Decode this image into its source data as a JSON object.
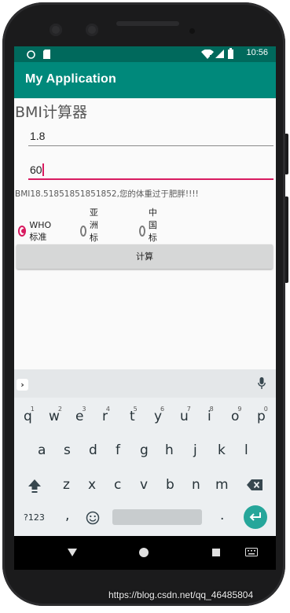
{
  "status_bar": {
    "time": "10:56"
  },
  "app_bar": {
    "title": "My Application"
  },
  "main": {
    "heading": "BMI计算器",
    "height_input": {
      "value": "1.8"
    },
    "weight_input": {
      "value": "60"
    },
    "result_text": "BMI18.51851851851852,您的体重过于肥胖!!!!",
    "standards": [
      {
        "label": "WHO标准",
        "checked": true
      },
      {
        "label": "亚洲标准",
        "checked": false
      },
      {
        "label": "中国标准",
        "checked": false
      }
    ],
    "calculate_label": "计算"
  },
  "keyboard": {
    "row1": [
      {
        "key": "q",
        "hint": "1"
      },
      {
        "key": "w",
        "hint": "2"
      },
      {
        "key": "e",
        "hint": "3"
      },
      {
        "key": "r",
        "hint": "4"
      },
      {
        "key": "t",
        "hint": "5"
      },
      {
        "key": "y",
        "hint": "6"
      },
      {
        "key": "u",
        "hint": "7"
      },
      {
        "key": "i",
        "hint": "8"
      },
      {
        "key": "o",
        "hint": "9"
      },
      {
        "key": "p",
        "hint": "0"
      }
    ],
    "row2": [
      "a",
      "s",
      "d",
      "f",
      "g",
      "h",
      "j",
      "k",
      "l"
    ],
    "row3": [
      "z",
      "x",
      "c",
      "v",
      "b",
      "n",
      "m"
    ],
    "symbols_label": "?123",
    "comma_label": ",",
    "period_label": "."
  },
  "watermark": "https://blog.csdn.net/qq_46485804",
  "colors": {
    "primary": "#00897b",
    "primary_dark": "#00695c",
    "accent": "#d81b60",
    "enter_key": "#26a69a"
  },
  "icons": [
    "wifi-icon",
    "signal-icon",
    "battery-icon",
    "sim-icon",
    "expand-suggestions-icon",
    "mic-icon",
    "shift-icon",
    "backspace-icon",
    "emoji-icon",
    "enter-icon",
    "back-nav-icon",
    "home-nav-icon",
    "recents-nav-icon",
    "keyboard-switch-icon"
  ]
}
